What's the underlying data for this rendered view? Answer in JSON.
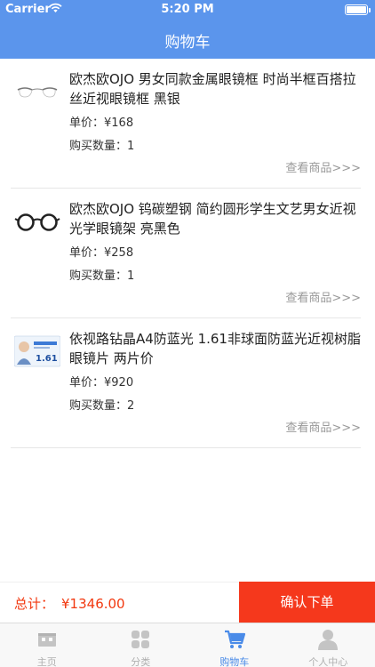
{
  "status_bar": {
    "carrier": "Carrier",
    "time": "5:20 PM"
  },
  "nav": {
    "title": "购物车"
  },
  "cart": {
    "items": [
      {
        "name": "欧杰欧OJO 男女同款金属眼镜框 时尚半框百搭拉丝近视眼镜框 黑银",
        "price_label": "单价：",
        "price": "¥168",
        "qty_label": "购买数量：",
        "qty": "1",
        "link": "查看商品>>>",
        "thumb": "half-rim-glasses"
      },
      {
        "name": "欧杰欧OJO 钨碳塑钢 简约圆形学生文艺男女近视光学眼镜架 亮黑色",
        "price_label": "单价：",
        "price": "¥258",
        "qty_label": "购买数量：",
        "qty": "1",
        "link": "查看商品>>>",
        "thumb": "round-black-glasses"
      },
      {
        "name": "依视路钻晶A4防蓝光 1.61非球面防蓝光近视树脂眼镜片 两片价",
        "price_label": "单价：",
        "price": "¥920",
        "qty_label": "购买数量：",
        "qty": "2",
        "link": "查看商品>>>",
        "thumb": "lens-package",
        "thumb_text": "1.61"
      }
    ]
  },
  "checkout": {
    "total_label": "总计：",
    "total": "¥1346.00",
    "confirm": "确认下单"
  },
  "tabs": [
    {
      "label": "主页",
      "icon": "home-icon"
    },
    {
      "label": "分类",
      "icon": "grid-icon"
    },
    {
      "label": "购物车",
      "icon": "cart-icon",
      "active": true
    },
    {
      "label": "个人中心",
      "icon": "person-icon"
    }
  ],
  "colors": {
    "brand": "#5b95ec",
    "accent": "#f5381c",
    "tab_active": "#4a8be8"
  }
}
